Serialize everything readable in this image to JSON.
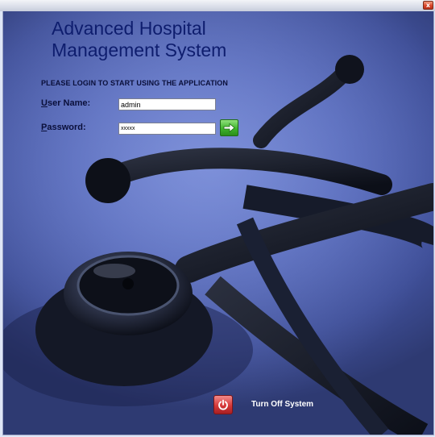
{
  "window": {
    "close_symbol": "x",
    "close_icon": "close-icon"
  },
  "app": {
    "title_line1": "Advanced Hospital",
    "title_line2": "Management System"
  },
  "login": {
    "instruction": "PLEASE LOGIN TO START USING THE APPLICATION",
    "username_label_mnemonic": "U",
    "username_label_rest": "ser Name:",
    "username_value": "admin",
    "password_label_mnemonic": "P",
    "password_label_rest": "assword:",
    "password_value": "xxxxx",
    "submit_icon": "arrow-right-icon"
  },
  "footer": {
    "turn_off_label": "Turn Off System",
    "power_icon": "power-icon"
  },
  "colors": {
    "title_text": "#0e1d6e",
    "background": "#4f62b2",
    "go_button": "#3fb52b",
    "power_button": "#d6393a"
  }
}
